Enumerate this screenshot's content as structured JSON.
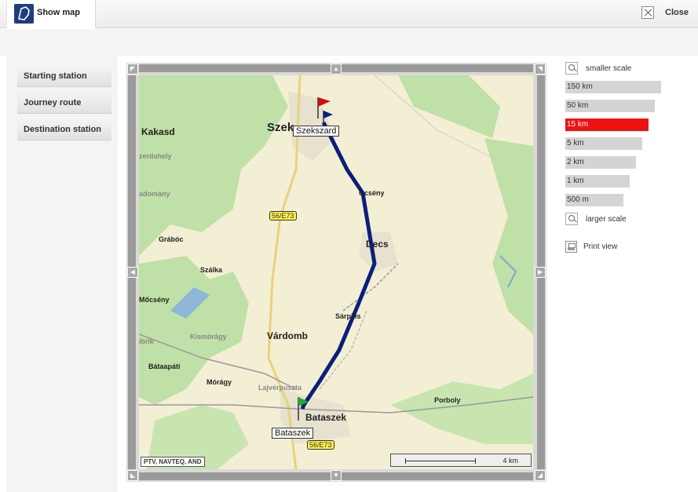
{
  "header": {
    "tab_title": "Show map",
    "close_label": "Close"
  },
  "nav": {
    "items": [
      {
        "label": "Starting station"
      },
      {
        "label": "Journey route"
      },
      {
        "label": "Destination station"
      }
    ]
  },
  "map": {
    "places": {
      "start": "Szekszard",
      "end": "Bataszek"
    },
    "towns": {
      "kakasd": "Kakasd",
      "szekszard_big": "Szek",
      "zerdahely": "zerdahely",
      "adomany": "adomány",
      "ocseny": "Ocsény",
      "decs": "Decs",
      "grabóc": "Grábóc",
      "szalka": "Szálka",
      "mocseny": "Mőcsény",
      "sarpilis": "Sárpilis",
      "vardomb": "Várdomb",
      "ibrik": "ibrik",
      "kismorágy": "Kismórágy",
      "bataapati": "Bátaapáti",
      "moragy": "Mórágy",
      "lajverpuszta": "Lajvérpuszta",
      "bataszek_big": "Bataszek",
      "porboly": "Porboly"
    },
    "roads": {
      "r1": "56/E73",
      "r2": "56/E73"
    },
    "copyright": "PTV, NAVTEQ, AND",
    "scale_label": "4 km",
    "colors": {
      "route": "#0b1f7a",
      "forest": "#bfe0a6",
      "land": "#f3efd5"
    }
  },
  "zoom": {
    "smaller_label": "smaller scale",
    "larger_label": "larger scale",
    "print_label": "Print view",
    "levels": [
      {
        "label": "150 km",
        "active": false
      },
      {
        "label": "50 km",
        "active": false
      },
      {
        "label": "15 km",
        "active": true
      },
      {
        "label": "5 km",
        "active": false
      },
      {
        "label": "2 km",
        "active": false
      },
      {
        "label": "1 km",
        "active": false
      },
      {
        "label": "500 m",
        "active": false
      }
    ],
    "active_color": "#ee1111"
  }
}
